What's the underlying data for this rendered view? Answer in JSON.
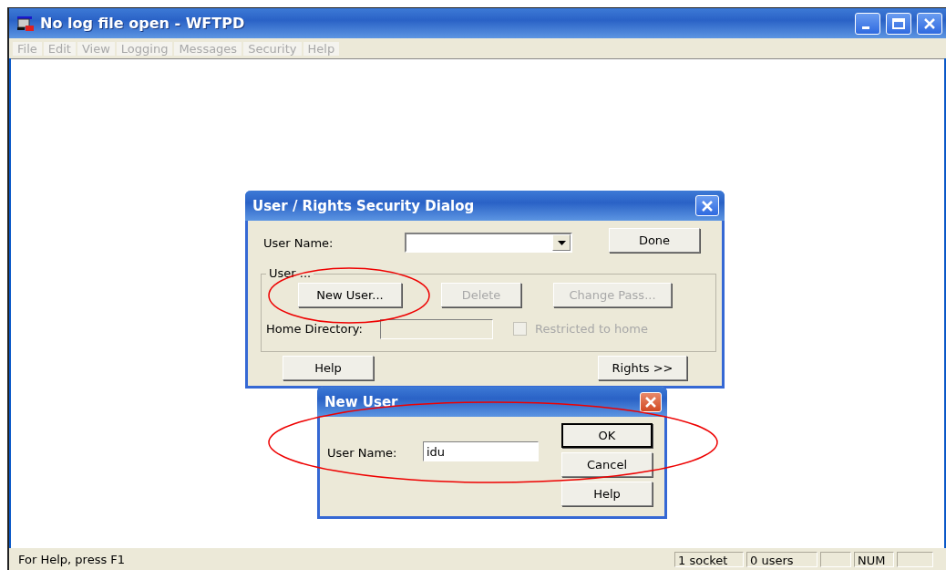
{
  "window": {
    "title": "No log file open - WFTPD"
  },
  "menu": [
    {
      "label": "File",
      "disabled": true
    },
    {
      "label": "Edit",
      "disabled": true
    },
    {
      "label": "View",
      "disabled": true
    },
    {
      "label": "Logging",
      "disabled": true
    },
    {
      "label": "Messages",
      "disabled": true
    },
    {
      "label": "Security",
      "disabled": true
    },
    {
      "label": "Help",
      "disabled": true
    }
  ],
  "security_dialog": {
    "title": "User / Rights Security Dialog",
    "user_name_label": "User Name:",
    "done_button": "Done",
    "group_label": "User ...",
    "buttons": [
      {
        "label": "New User...",
        "disabled": false
      },
      {
        "label": "Delete",
        "disabled": true
      },
      {
        "label": "Change Pass...",
        "disabled": true
      }
    ],
    "home_directory_label": "Home Directory:",
    "home_directory_disabled": true,
    "restricted": {
      "label": "Restricted to home",
      "checked": false,
      "disabled": true
    },
    "help_button": "Help",
    "rights_button": "Rights >>"
  },
  "new_user_dialog": {
    "title": "New User",
    "user_name_label": "User Name:",
    "user_name_value": "idu",
    "buttons": [
      {
        "label": "OK",
        "default": true
      },
      {
        "label": "Cancel",
        "default": false
      },
      {
        "label": "Help",
        "default": false
      }
    ]
  },
  "status_bar": {
    "message": "For Help, press F1",
    "panes": [
      {
        "kind": "text",
        "text": "1 socket"
      },
      {
        "kind": "text",
        "text": "0 users"
      },
      {
        "kind": "blank"
      },
      {
        "kind": "text",
        "text": "NUM"
      },
      {
        "kind": "blank"
      }
    ]
  }
}
